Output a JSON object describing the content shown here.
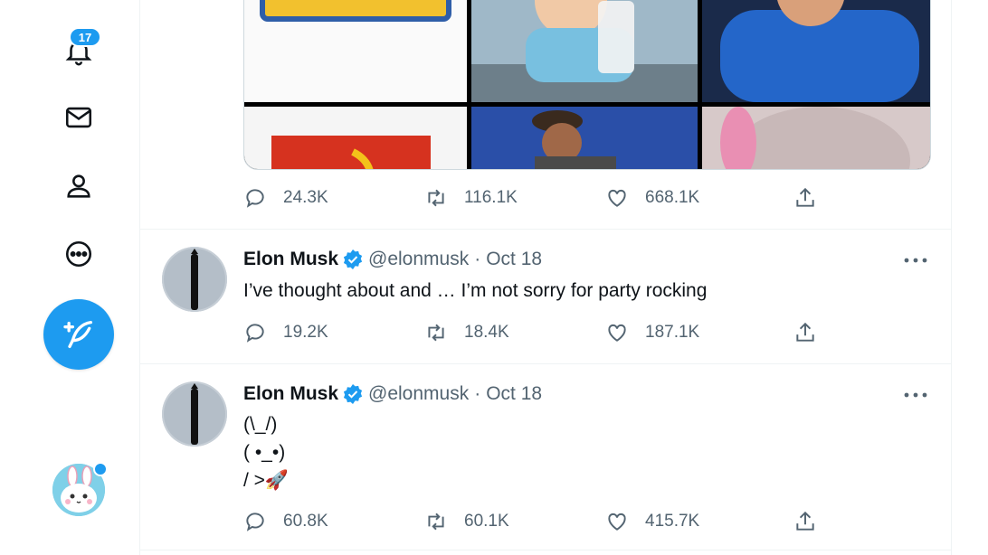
{
  "nav": {
    "notifications_badge": "17",
    "icons": [
      "bell-icon",
      "mail-icon",
      "person-icon",
      "more-circle-icon",
      "compose-feather-icon"
    ]
  },
  "first_tweet": {
    "actions": {
      "replies": "24.3K",
      "retweets": "116.1K",
      "likes": "668.1K"
    }
  },
  "tweets": [
    {
      "name": "Elon Musk",
      "handle": "@elonmusk",
      "separator": "·",
      "time": "Oct 18",
      "text": "I’ve thought about and … I’m not sorry for party rocking",
      "actions": {
        "replies": "19.2K",
        "retweets": "18.4K",
        "likes": "187.1K"
      }
    },
    {
      "name": "Elon Musk",
      "handle": "@elonmusk",
      "separator": "·",
      "time": "Oct 18",
      "text_lines": [
        "(\\_/)",
        "( •_•)",
        "/ >🚀"
      ],
      "actions": {
        "replies": "60.8K",
        "retweets": "60.1K",
        "likes": "415.7K"
      }
    }
  ],
  "colors": {
    "accent": "#1d9bf0",
    "muted": "#536471",
    "text": "#0f1419",
    "border": "#eff3f4"
  }
}
